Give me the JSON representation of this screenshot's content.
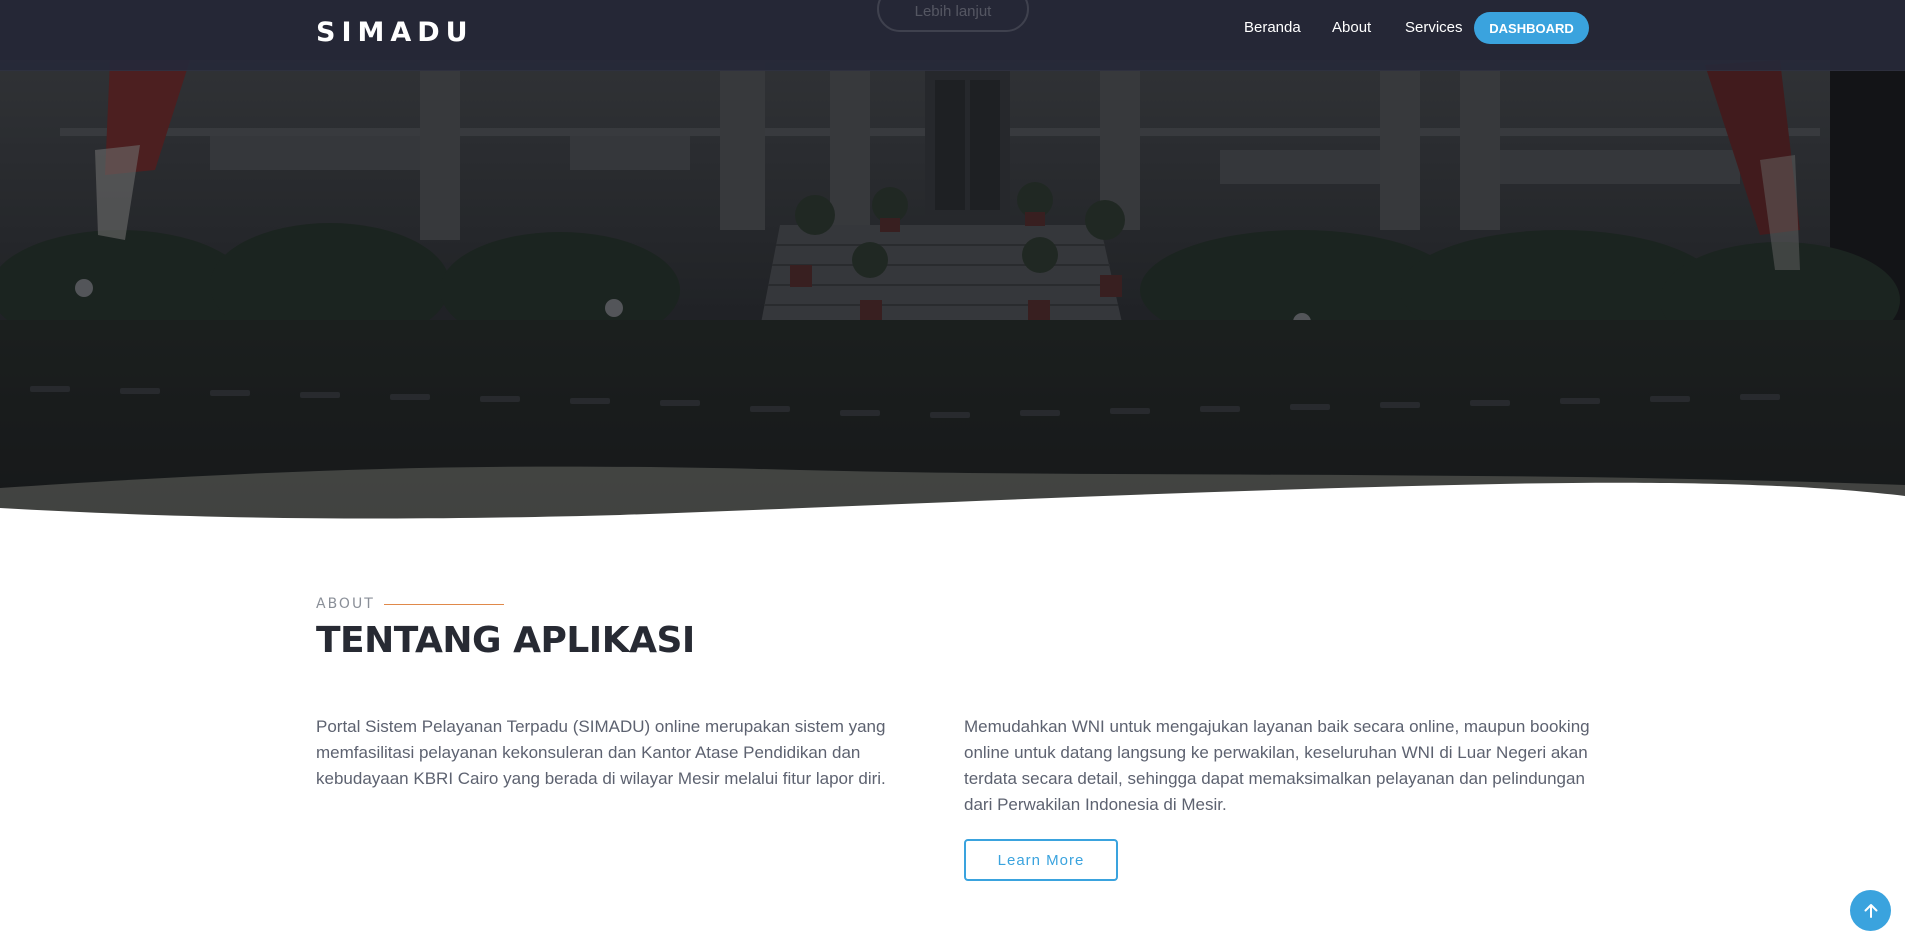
{
  "navbar": {
    "brand": "SIMADU",
    "hero_button": "Lebih lanjut",
    "links": {
      "home": "Beranda",
      "about": "About",
      "services": "Services"
    },
    "dashboard": "DASHBOARD"
  },
  "about": {
    "eyebrow": "ABOUT",
    "title": "TENTANG APLIKASI",
    "left_text": "Portal Sistem Pelayanan Terpadu (SIMADU) online merupakan sistem yang memfasilitasi pelayanan kekonsuleran dan Kantor Atase Pendidikan dan kebudayaan KBRI Cairo yang berada di wilayar Mesir melalui fitur lapor diri.",
    "right_text": "Memudahkan WNI untuk mengajukan layanan baik secara online, maupun booking online untuk datang langsung ke perwakilan, keseluruhan WNI di Luar Negeri akan terdata secara detail, sehingga dapat memaksimalkan pelayanan dan pelindungan dari Perwakilan Indonesia di Mesir.",
    "learn_more": "Learn More"
  },
  "colors": {
    "accent": "#3aa3de",
    "eyebrow_line": "#e0894a",
    "title": "#272a33",
    "navbar": "#262838"
  },
  "icons": {
    "scroll_top": "arrow-up-icon"
  }
}
